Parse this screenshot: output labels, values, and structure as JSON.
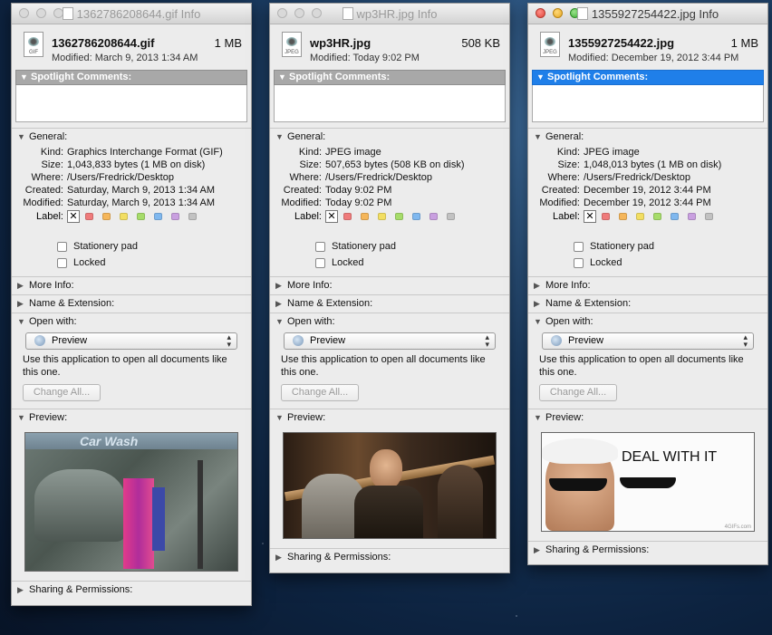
{
  "windows": [
    {
      "title": "1362786208644.gif Info",
      "filename": "1362786208644.gif",
      "size": "1 MB",
      "ext_badge": "GIF",
      "modified": "Modified: March 9, 2013 1:34 AM",
      "spotlight_label": "Spotlight Comments:",
      "general_label": "General:",
      "kind_label": "Kind:",
      "kind": "Graphics Interchange Format (GIF)",
      "size_label": "Size:",
      "size_detail": "1,043,833 bytes (1 MB on disk)",
      "where_label": "Where:",
      "where": "/Users/Fredrick/Desktop",
      "created_label": "Created:",
      "created": "Saturday, March 9, 2013 1:34 AM",
      "modified_label": "Modified:",
      "modified_detail": "Saturday, March 9, 2013 1:34 AM",
      "label_label": "Label:",
      "stationery": "Stationery pad",
      "locked": "Locked",
      "more_info": "More Info:",
      "name_ext": "Name & Extension:",
      "open_with": "Open with:",
      "app": "Preview",
      "open_msg": "Use this application to open all documents like this one.",
      "change_all": "Change All...",
      "preview_label": "Preview:",
      "preview_text": "Car Wash",
      "sharing": "Sharing & Permissions:"
    },
    {
      "title": "wp3HR.jpg Info",
      "filename": "wp3HR.jpg",
      "size": "508 KB",
      "ext_badge": "JPEG",
      "modified": "Modified: Today 9:02 PM",
      "spotlight_label": "Spotlight Comments:",
      "general_label": "General:",
      "kind_label": "Kind:",
      "kind": "JPEG image",
      "size_label": "Size:",
      "size_detail": "507,653 bytes (508 KB on disk)",
      "where_label": "Where:",
      "where": "/Users/Fredrick/Desktop",
      "created_label": "Created:",
      "created": "Today 9:02 PM",
      "modified_label": "Modified:",
      "modified_detail": "Today 9:02 PM",
      "label_label": "Label:",
      "stationery": "Stationery pad",
      "locked": "Locked",
      "more_info": "More Info:",
      "name_ext": "Name & Extension:",
      "open_with": "Open with:",
      "app": "Preview",
      "open_msg": "Use this application to open all documents like this one.",
      "change_all": "Change All...",
      "preview_label": "Preview:",
      "sharing": "Sharing & Permissions:"
    },
    {
      "title": "1355927254422.jpg Info",
      "filename": "1355927254422.jpg",
      "size": "1 MB",
      "ext_badge": "JPEG",
      "modified": "Modified: December 19, 2012 3:44 PM",
      "spotlight_label": "Spotlight Comments:",
      "general_label": "General:",
      "kind_label": "Kind:",
      "kind": "JPEG image",
      "size_label": "Size:",
      "size_detail": "1,048,013 bytes (1 MB on disk)",
      "where_label": "Where:",
      "where": "/Users/Fredrick/Desktop",
      "created_label": "Created:",
      "created": "December 19, 2012 3:44 PM",
      "modified_label": "Modified:",
      "modified_detail": "December 19, 2012 3:44 PM",
      "label_label": "Label:",
      "stationery": "Stationery pad",
      "locked": "Locked",
      "more_info": "More Info:",
      "name_ext": "Name & Extension:",
      "open_with": "Open with:",
      "app": "Preview",
      "open_msg": "Use this application to open all documents like this one.",
      "change_all": "Change All...",
      "preview_label": "Preview:",
      "preview_text": "DEAL WITH IT",
      "preview_watermark": "4GIFs.com",
      "sharing": "Sharing & Permissions:"
    }
  ],
  "label_colors": [
    "#ef7b7b",
    "#f5b65a",
    "#f2de62",
    "#a6dc6a",
    "#7fb8ef",
    "#c9a0e0",
    "#c2c2c2"
  ]
}
